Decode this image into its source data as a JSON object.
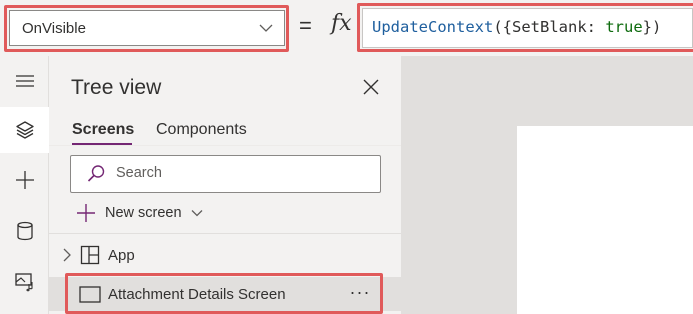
{
  "formula_bar": {
    "property": "OnVisible",
    "equals": "=",
    "fx": "fx",
    "formula": {
      "function": "UpdateContext",
      "open": "({",
      "identifier": "SetBlank",
      "colon": ": ",
      "value": "true",
      "close": "})"
    }
  },
  "left_rail": {
    "items": [
      "hamburger-menu-icon",
      "layers-icon",
      "plus-icon",
      "database-icon",
      "media-icon"
    ],
    "active": "layers-icon"
  },
  "tree_view": {
    "title": "Tree view",
    "tabs": [
      "Screens",
      "Components"
    ],
    "active_tab": "Screens",
    "search": {
      "placeholder": "Search",
      "value": ""
    },
    "new_screen_label": "New screen",
    "items": [
      {
        "label": "App",
        "icon": "app-icon",
        "expandable": true
      },
      {
        "label": "Attachment Details Screen",
        "icon": "screen-icon",
        "selected": true,
        "more": "···"
      }
    ]
  },
  "colors": {
    "accent": "#742774",
    "highlight": "#e05a5a",
    "formula_function": "#1f5f9e",
    "formula_boolean": "#0e6b0e"
  }
}
